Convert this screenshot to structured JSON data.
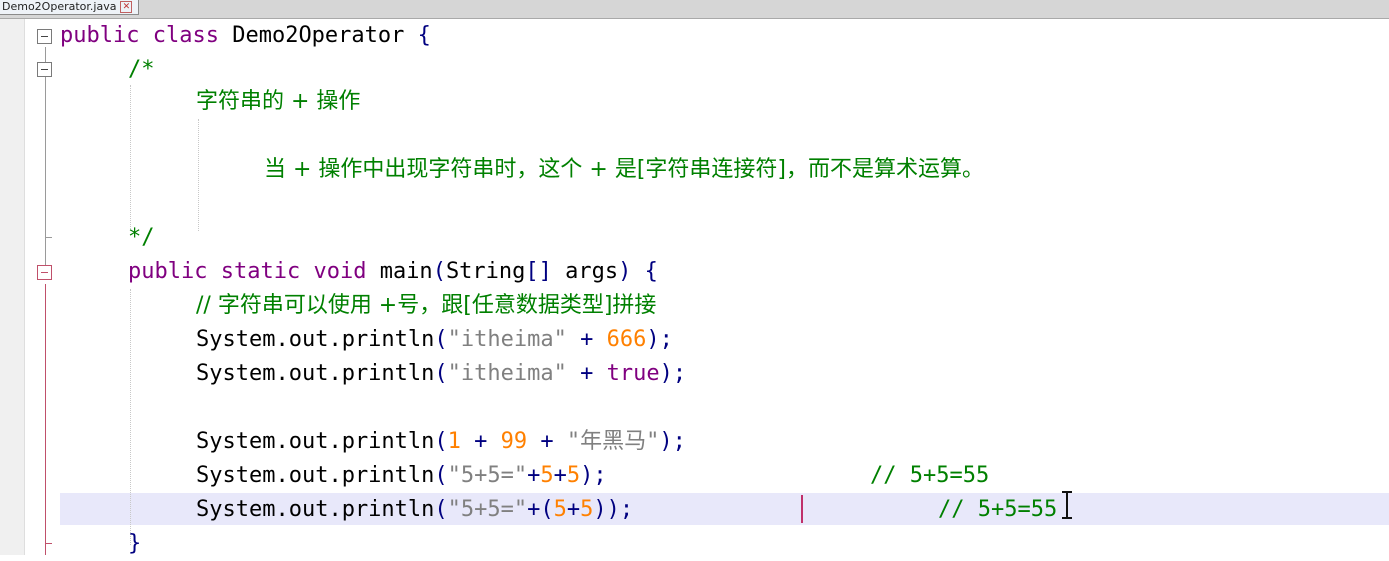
{
  "tab": {
    "title": "Demo2Operator.java",
    "close_glyph": "✕"
  },
  "code": {
    "line1": {
      "kw1": "public",
      "kw2": "class",
      "name": " Demo2Operator ",
      "brace": "{"
    },
    "line2": {
      "text": "/*"
    },
    "line3": {
      "text": "字符串的 + 操作"
    },
    "line4": {
      "text": "当 + 操作中出现字符串时，这个 + 是[字符串连接符]，而不是算术运算。"
    },
    "line5": {
      "text": "*/"
    },
    "line6": {
      "kw1": "public",
      "kw2": "static",
      "kw3": "void",
      "name": " main",
      "p1": "(",
      "type": "String",
      "arr": "[]",
      "args": " args",
      "p2": ")",
      "brace": " {"
    },
    "line7": {
      "text": "// 字符串可以使用 +号，跟[任意数据类型]拼接"
    },
    "line8": {
      "call": "System.out.println",
      "p1": "(",
      "str": "\"itheima\"",
      "plus": " + ",
      "num": "666",
      "p2": ")",
      "semi": ";"
    },
    "line9": {
      "call": "System.out.println",
      "p1": "(",
      "str": "\"itheima\"",
      "plus": " + ",
      "kw": "true",
      "p2": ")",
      "semi": ";"
    },
    "line10": {
      "call": "System.out.println",
      "p1": "(",
      "n1": "1",
      "plus1": " + ",
      "n2": "99",
      "plus2": " + ",
      "str": "\"年黑马\"",
      "p2": ")",
      "semi": ";"
    },
    "line11": {
      "call": "System.out.println",
      "p1": "(",
      "str": "\"5+5=\"",
      "plus1": "+",
      "n1": "5",
      "plus2": "+",
      "n2": "5",
      "p2": ")",
      "semi": ";",
      "comment": "// 5+5=55"
    },
    "line12": {
      "call": "System.out.println",
      "p1": "(",
      "str": "\"5+5=\"",
      "plus1": "+",
      "p3": "(",
      "n1": "5",
      "plus2": "+",
      "n2": "5",
      "p4": "))",
      "semi": ";",
      "comment": "// 5+5=55"
    },
    "line13": {
      "text": "}"
    }
  },
  "colors": {
    "keyword": "#800080",
    "comment": "#008000",
    "string": "#808080",
    "number": "#ff8000",
    "operator": "#000080",
    "current_line": "#e8e8fa",
    "fold_marker_active": "#c0506a"
  }
}
